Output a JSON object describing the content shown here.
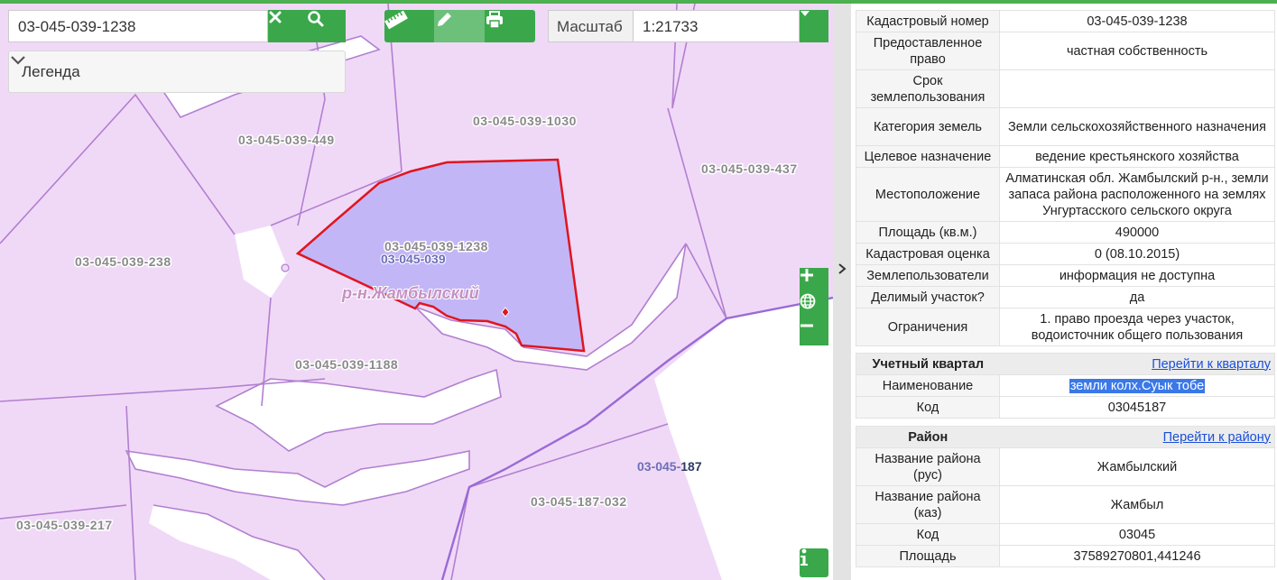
{
  "map": {
    "search_value": "03-045-039-1238",
    "legend_label": "Легенда",
    "scale_label": "Масштаб",
    "scale_value": "1:21733",
    "parcel_labels": [
      {
        "text": "03-045-039-1030",
        "id": "p1030"
      },
      {
        "text": "03-045-039-449",
        "id": "p449"
      },
      {
        "text": "03-045-039-437",
        "id": "p437"
      },
      {
        "text": "03-045-039-238",
        "id": "p238"
      },
      {
        "text": "03-045-039-1238",
        "id": "p1238"
      },
      {
        "text": "03-045-039-1188",
        "id": "p1188"
      },
      {
        "text": "03-045-187-032",
        "id": "p032"
      },
      {
        "text": "03-045-039-217",
        "id": "p217"
      }
    ],
    "quarter_label": "03-045-039",
    "quarter_label_2_prefix": "03-045-",
    "quarter_label_2_suffix": "187",
    "district_label": "р-н.Жамбылский",
    "colors": {
      "parcel_fill": "#f0d9f7",
      "parcel_border": "#b27fd0",
      "selected_fill": "#c3b6f7",
      "selected_border": "#e0151f",
      "button_green": "#3aa84a"
    }
  },
  "parcel_info": {
    "rows": [
      {
        "key": "Кадастровый номер",
        "value": "03-045-039-1238"
      },
      {
        "key": "Предоставленное право",
        "value": "частная собственность"
      },
      {
        "key": "Срок землепользования",
        "value": ""
      },
      {
        "key": "Категория земель",
        "value": "Земли сельскохозяйственного назначения"
      },
      {
        "key": "Целевое назначение",
        "value": "ведение крестьянского хозяйства"
      },
      {
        "key": "Местоположение",
        "value": "Алматинская обл. Жамбылский р-н., земли запаса района расположенного на землях Унгуртасского сельского округа"
      },
      {
        "key": "Площадь (кв.м.)",
        "value": "490000"
      },
      {
        "key": "Кадастровая оценка",
        "value": "0 (08.10.2015)"
      },
      {
        "key": "Землепользователи",
        "value": "информация не доступна"
      },
      {
        "key": "Делимый участок?",
        "value": "да"
      },
      {
        "key": "Ограничения",
        "value": "1. право проезда через участок, водоисточник общего пользования"
      }
    ]
  },
  "quarter_info": {
    "title": "Учетный квартал",
    "link": "Перейти к кварталу",
    "rows": [
      {
        "key": "Наименование",
        "value": "земли колх.Суык тобе"
      },
      {
        "key": "Код",
        "value": "03045187"
      }
    ]
  },
  "district_info": {
    "title": "Район",
    "link": "Перейти к району",
    "rows": [
      {
        "key": "Название района (рус)",
        "value": "Жамбылский"
      },
      {
        "key": "Название района (каз)",
        "value": "Жамбыл"
      },
      {
        "key": "Код",
        "value": "03045"
      },
      {
        "key": "Площадь",
        "value": "37589270801,441246"
      }
    ]
  }
}
